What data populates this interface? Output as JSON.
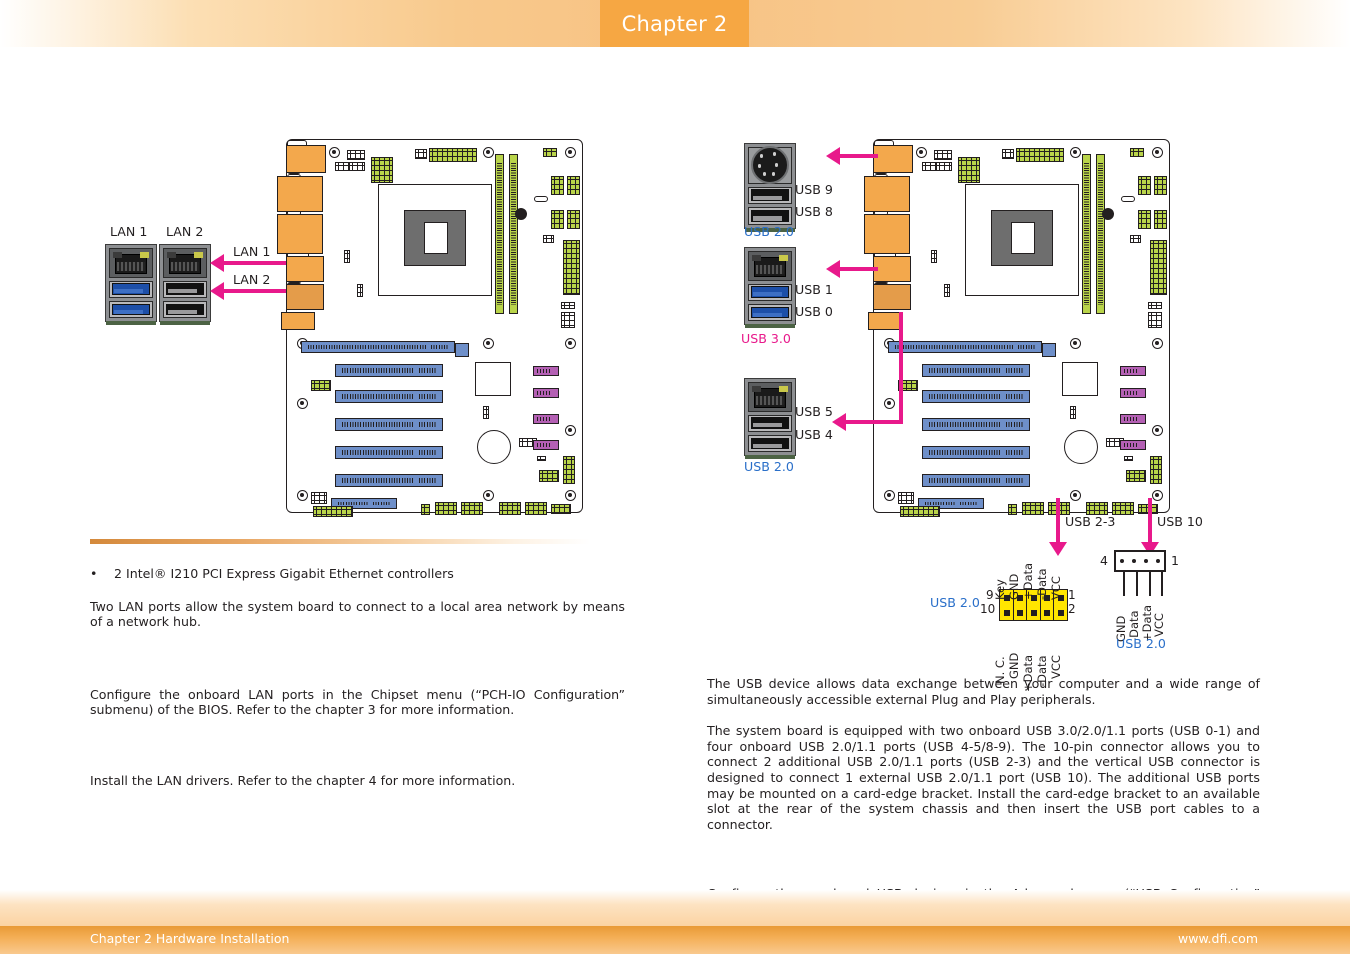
{
  "header": {
    "chapter_tab": "Chapter 2"
  },
  "footer": {
    "left": "Chapter 2 Hardware Installation",
    "right": "www.dfi.com"
  },
  "colors": {
    "accent_orange": "#f6a743",
    "magenta": "#e8198b",
    "usb2_blue": "#2a6fc9",
    "pcb_orange": "#f3a84c",
    "pcb_green": "#b9d44a",
    "pcb_blue": "#6e8fc9",
    "pcb_purple": "#b460b4",
    "pin_yellow": "#ffe500"
  },
  "left_column": {
    "diagram": {
      "port_labels": {
        "lan1": "LAN 1",
        "lan2": "LAN 2"
      },
      "callouts": [
        {
          "id": "lan1-callout",
          "text": "LAN 1"
        },
        {
          "id": "lan2-callout",
          "text": "LAN 2"
        }
      ]
    },
    "bullets": [
      {
        "marker": "•",
        "text": "2 Intel® I210 PCI Express Gigabit Ethernet controllers"
      }
    ],
    "paragraphs": [
      "Two LAN ports allow the system board to connect to a local area network by means of a network hub.",
      "Configure the onboard LAN ports in the Chipset menu (“PCH-IO Configuration” submenu) of the BIOS. Refer to the chapter 3 for more information.",
      "Install the LAN drivers. Refer to the chapter 4 for more information."
    ]
  },
  "right_column": {
    "diagram": {
      "stacks": [
        {
          "id": "stack-usb-9-8",
          "top_port": "ps2",
          "labels": [
            "USB 9",
            "USB 8"
          ],
          "badge": "USB 2.0",
          "badge_kind": "usb2"
        },
        {
          "id": "stack-usb-1-0",
          "top_port": "rj45",
          "labels": [
            "USB 1",
            "USB 0"
          ],
          "badge": "USB 3.0",
          "badge_kind": "usb3"
        },
        {
          "id": "stack-usb-5-4",
          "top_port": "rj45",
          "labels": [
            "USB 5",
            "USB 4"
          ],
          "badge": "USB 2.0",
          "badge_kind": "usb2"
        }
      ],
      "bottom_callouts": [
        {
          "id": "usb-2-3-callout",
          "text": "USB 2-3"
        },
        {
          "id": "usb-10-callout",
          "text": "USB 10"
        }
      ],
      "pin_header": {
        "badge": "USB 2.0",
        "left_pins": [
          "9",
          "10"
        ],
        "right_pins": [
          "1",
          "2"
        ],
        "top_signals": [
          "Key",
          "GND",
          "+Data",
          "-Data",
          "VCC"
        ],
        "bottom_signals": [
          "N. C.",
          "GND",
          "+Data",
          "-Data",
          "VCC"
        ]
      },
      "vertical_connector": {
        "badge": "USB 2.0",
        "left_pin": "4",
        "right_pin": "1",
        "signals": [
          "GND",
          "-Data",
          "+Data",
          "VCC"
        ]
      }
    },
    "paragraphs": [
      "The USB device allows data exchange between your computer and a wide range of simultaneously accessible external Plug and Play peripherals.",
      "The system board is equipped with two onboard USB 3.0/2.0/1.1 ports (USB 0-1) and four onboard USB 2.0/1.1 ports (USB 4-5/8-9). The 10-pin connector allows you to connect 2 additional USB 2.0/1.1 ports (USB 2-3) and the vertical USB connector is designed to connect 1 external USB 2.0/1.1 port (USB 10). The additional USB ports may be mounted on a card-edge bracket. Install the card-edge bracket to an available slot at the rear of the system chassis and then insert the USB port cables to a connector.",
      "Configure these onboard USB devices in the Advanced menu (“USB Configuration” submenu) of the BIOS. Refer to the chapter 3 for more information."
    ]
  }
}
